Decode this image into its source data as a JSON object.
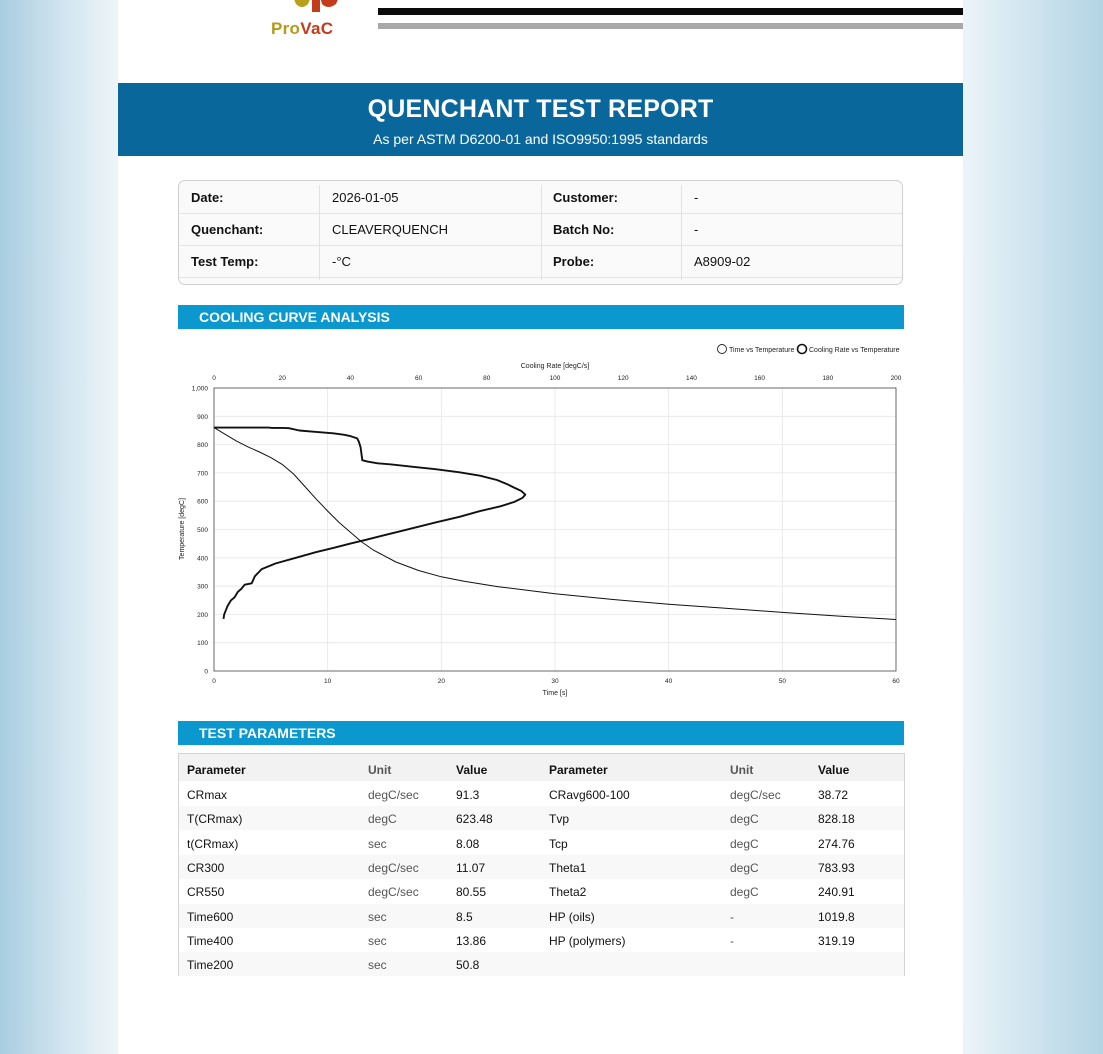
{
  "header": {
    "logo_pro": "Pro",
    "logo_vac": "VaC",
    "title": "QUENCHANT TEST REPORT",
    "subtitle": "As per ASTM D6200-01 and ISO9950:1995 standards"
  },
  "info": {
    "date_label": "Date:",
    "date_value": "2026-01-05",
    "customer_label": "Customer:",
    "customer_value": "-",
    "quenchant_label": "Quenchant:",
    "quenchant_value": "CLEAVERQUENCH",
    "batch_label": "Batch No:",
    "batch_value": "-",
    "temp_label": "Test Temp:",
    "temp_value": "-°C",
    "probe_label": "Probe:",
    "probe_value": "A8909-02"
  },
  "sections": {
    "cooling": "COOLING CURVE ANALYSIS",
    "params": "TEST PARAMETERS"
  },
  "chart_data": {
    "type": "line",
    "title": "",
    "xlabel": "Time [s]",
    "x2label": "Cooling Rate [degC/s]",
    "ylabel": "Temperature [degC]",
    "xlim": [
      0,
      60
    ],
    "x2lim": [
      0,
      200
    ],
    "ylim": [
      0,
      1000
    ],
    "x_ticks": [
      0,
      10,
      20,
      30,
      40,
      50,
      60
    ],
    "x2_ticks": [
      0,
      20,
      40,
      60,
      80,
      100,
      120,
      140,
      160,
      180,
      200
    ],
    "y_ticks": [
      0,
      100,
      200,
      300,
      400,
      500,
      600,
      700,
      800,
      900
    ],
    "y_top_label": "1,000",
    "grid": true,
    "legend_position": "top-right",
    "series": [
      {
        "name": "Time vs Temperature",
        "axis": "bottom",
        "x": [
          0,
          1,
          2,
          3,
          4,
          5,
          6,
          7,
          8,
          9,
          10,
          11,
          12,
          13,
          14,
          16,
          18,
          20,
          22,
          25,
          30,
          35,
          40,
          45,
          50,
          55,
          60
        ],
        "y": [
          860,
          836,
          812,
          792,
          774,
          754,
          730,
          696,
          652,
          607,
          565,
          525,
          490,
          456,
          428,
          385,
          355,
          333,
          317,
          298,
          273,
          253,
          236,
          222,
          207,
          194,
          182
        ]
      },
      {
        "name": "Cooling Rate vs Temperature",
        "axis": "top",
        "x": [
          0,
          16,
          17,
          18,
          20,
          22,
          25,
          30,
          35,
          38,
          40,
          42,
          42.5,
          43,
          43.5,
          45,
          48,
          52,
          58,
          65,
          72,
          78,
          83,
          86,
          88,
          90,
          91.3,
          90.5,
          88,
          84,
          78,
          72,
          65,
          55,
          45,
          40,
          35,
          30,
          24,
          18,
          14,
          12,
          11.07,
          9,
          8,
          7,
          6.5,
          6,
          5,
          4.5,
          4,
          3.5,
          3,
          2.8
        ],
        "y": [
          860,
          860,
          859,
          859,
          859,
          858,
          850,
          845,
          840,
          835,
          830,
          822,
          810,
          790,
          745,
          740,
          734,
          730,
          722,
          713,
          702,
          690,
          675,
          660,
          648,
          637,
          623.48,
          612,
          597,
          582,
          565,
          545,
          525,
          495,
          465,
          450,
          435,
          420,
          400,
          380,
          360,
          335,
          310,
          305,
          290,
          280,
          270,
          260,
          250,
          240,
          230,
          215,
          200,
          184
        ]
      }
    ]
  },
  "params": {
    "headers": [
      "Parameter",
      "Unit",
      "Value",
      "Parameter",
      "Unit",
      "Value"
    ],
    "rows": [
      [
        "CRmax",
        "degC/sec",
        "91.3",
        "CRavg600-100",
        "degC/sec",
        "38.72"
      ],
      [
        "T(CRmax)",
        "degC",
        "623.48",
        "Tvp",
        "degC",
        "828.18"
      ],
      [
        "t(CRmax)",
        "sec",
        "8.08",
        "Tcp",
        "degC",
        "274.76"
      ],
      [
        "CR300",
        "degC/sec",
        "11.07",
        "Theta1",
        "degC",
        "783.93"
      ],
      [
        "CR550",
        "degC/sec",
        "80.55",
        "Theta2",
        "degC",
        "240.91"
      ],
      [
        "Time600",
        "sec",
        "8.5",
        "HP (oils)",
        "-",
        "1019.8"
      ],
      [
        "Time400",
        "sec",
        "13.86",
        "HP (polymers)",
        "-",
        "319.19"
      ],
      [
        "Time200",
        "sec",
        "50.8",
        "",
        "",
        ""
      ]
    ]
  }
}
